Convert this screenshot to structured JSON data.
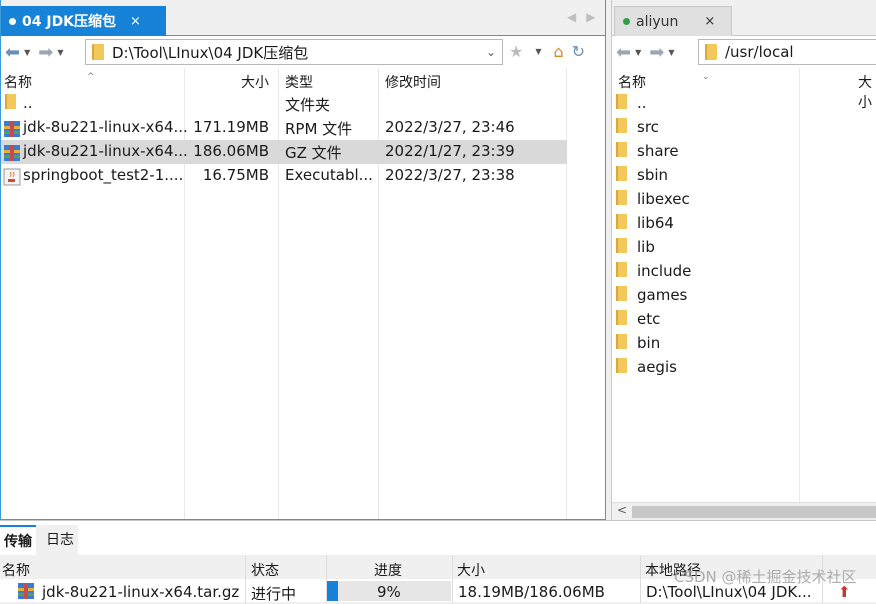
{
  "left": {
    "tab": {
      "label": "04 JDK压缩包",
      "close": "×"
    },
    "path": "D:\\Tool\\LInux\\04 JDK压缩包",
    "columns": {
      "name": "名称",
      "size": "大小",
      "type": "类型",
      "modified": "修改时间"
    },
    "rows": [
      {
        "name": "..",
        "size": "",
        "type": "文件夹",
        "modified": "",
        "icon": "folder-icon"
      },
      {
        "name": "jdk-8u221-linux-x64...",
        "size": "171.19MB",
        "type": "RPM 文件",
        "modified": "2022/3/27, 23:46",
        "icon": "archive-icon"
      },
      {
        "name": "jdk-8u221-linux-x64...",
        "size": "186.06MB",
        "type": "GZ 文件",
        "modified": "2022/1/27, 23:39",
        "icon": "archive-icon",
        "selected": true
      },
      {
        "name": "springboot_test2-1....",
        "size": "16.75MB",
        "type": "Executabl...",
        "modified": "2022/3/27, 23:38",
        "icon": "java-icon"
      }
    ]
  },
  "right": {
    "tab": {
      "label": "aliyun",
      "close": "×",
      "status_color": "#2ea043"
    },
    "path": "/usr/local",
    "columns": {
      "name": "名称",
      "size": "大小"
    },
    "rows": [
      "..",
      "src",
      "share",
      "sbin",
      "libexec",
      "lib64",
      "lib",
      "include",
      "games",
      "etc",
      "bin",
      "aegis"
    ]
  },
  "bottom": {
    "tabs": [
      "传输",
      "日志"
    ],
    "columns": {
      "name": "名称",
      "status": "状态",
      "progress": "进度",
      "size": "大小",
      "local_path": "本地路径"
    },
    "transfer": {
      "name": "jdk-8u221-linux-x64.tar.gz",
      "status": "进行中",
      "progress_text": "9%",
      "progress": 0.09,
      "size": "18.19MB/186.06MB",
      "local_path": "D:\\Tool\\LInux\\04 JDK..."
    }
  },
  "watermark": "CSDN @稀土掘金技术社区"
}
